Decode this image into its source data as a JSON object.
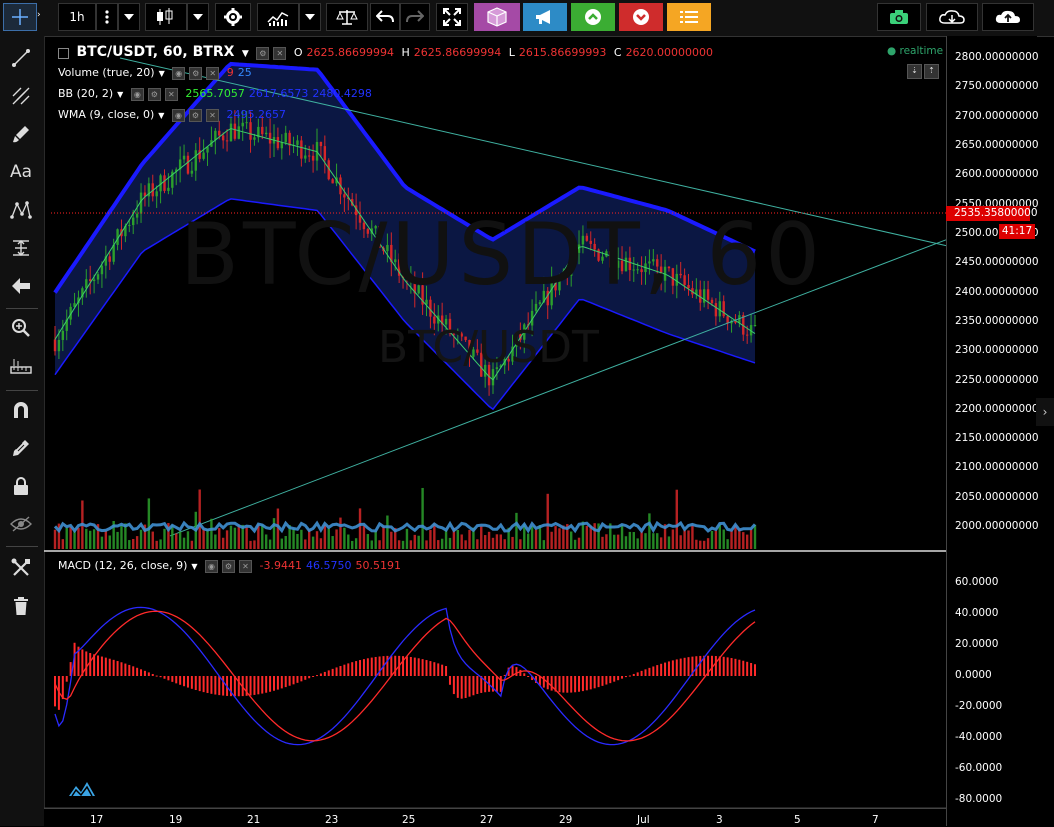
{
  "toolbar": {
    "interval": "1h"
  },
  "symbol_legend": {
    "title": "BTC/USDT, 60, BTRX",
    "o_label": "O",
    "o_value": "2625.86699994",
    "h_label": "H",
    "h_value": "2625.86699994",
    "l_label": "L",
    "l_value": "2615.86699993",
    "c_label": "C",
    "c_value": "2620.00000000",
    "realtime": "realtime"
  },
  "indicators": {
    "volume": {
      "label": "Volume (true, 20)",
      "v1": "9",
      "v2": "25"
    },
    "bb": {
      "label": "BB (20, 2)",
      "v1": "2565.7057",
      "v2": "2617.6573",
      "v3": "2480.4298"
    },
    "wma": {
      "label": "WMA (9, close, 0)",
      "v1": "2495.2657"
    },
    "macd": {
      "label": "MACD (12, 26, close, 9)",
      "v1": "-3.9441",
      "v2": "46.5750",
      "v3": "50.5191"
    }
  },
  "watermark": {
    "big": "BTC/USDT, 60",
    "small": "BTC/USDT"
  },
  "price_axis": {
    "labels": [
      "2800.00000000",
      "2750.00000000",
      "2700.00000000",
      "2650.00000000",
      "2600.00000000",
      "2550.00000000",
      "2500.00000000",
      "2450.00000000",
      "2400.00000000",
      "2350.00000000",
      "2300.00000000",
      "2250.00000000",
      "2200.00000000",
      "2150.00000000",
      "2100.00000000",
      "2050.00000000",
      "2000.00000000"
    ],
    "current_price": "2535.35800000",
    "countdown": "41:17"
  },
  "macd_axis": {
    "labels": [
      "60.0000",
      "40.0000",
      "20.0000",
      "0.0000",
      "-20.0000",
      "-40.0000",
      "-60.0000",
      "-80.0000"
    ]
  },
  "time_axis": {
    "labels": [
      "17",
      "19",
      "21",
      "23",
      "25",
      "27",
      "29",
      "Jul",
      "3",
      "5",
      "7"
    ]
  },
  "colors": {
    "bb_band": "#1a1aff",
    "bull": "#2ca02c",
    "bear": "#d62728",
    "trendline": "#3fb0a0",
    "price_line": "#ff2222",
    "macd_signal": "#ff2a2a",
    "macd_line": "#2a2aff",
    "volume_ma": "#3f8fd0"
  },
  "chart_data": {
    "type": "line",
    "x": [
      "17",
      "19",
      "21",
      "23",
      "25",
      "27",
      "29",
      "Jul",
      "3"
    ],
    "series": [
      {
        "values": [
          2320,
          2560,
          2680,
          2640,
          2420,
          2250,
          2480,
          2430,
          2330
        ]
      },
      {
        "values": [
          2400,
          2620,
          2790,
          2780,
          2580,
          2490,
          2580,
          2540,
          2470
        ]
      },
      {
        "values": [
          2260,
          2470,
          2560,
          2540,
          2350,
          2200,
          2390,
          2330,
          2280
        ]
      }
    ],
    "xlabel": "",
    "ylabel": "",
    "ylim": [
      1980,
      2820
    ]
  }
}
